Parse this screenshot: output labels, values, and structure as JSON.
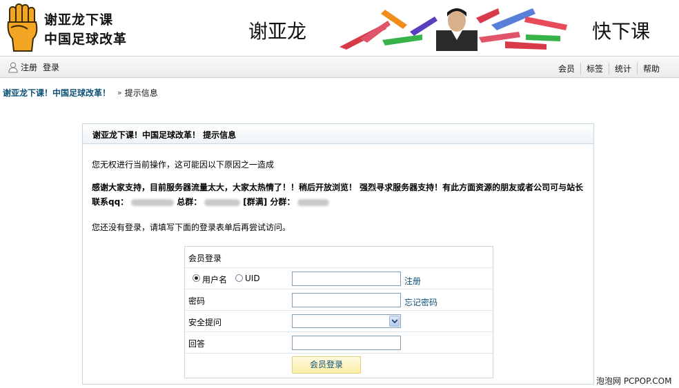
{
  "banner": {
    "logo_line1": "谢亚龙下课",
    "logo_line2": "中国足球改革",
    "left_text": "谢亚龙",
    "right_text": "快下课"
  },
  "nav": {
    "left": [
      {
        "label": "注册",
        "icon": "user-icon"
      },
      {
        "label": "登录"
      }
    ],
    "right": [
      "会员",
      "标签",
      "统计",
      "帮助"
    ]
  },
  "breadcrumb": {
    "home": "谢亚龙下课！中国足球改革！",
    "separator": "»",
    "current": "提示信息"
  },
  "box": {
    "title": "谢亚龙下课！中国足球改革！  提示信息",
    "message": "您无权进行当前操作，这可能因以下原因之一造成",
    "notice_text": "感谢大家支持，目前服务器流量太大，大家太热情了！！稍后开放浏览！  强烈寻求服务器支持！有此方面资源的朋友或者公司可与站长联系qq：",
    "notice_group_label": "总群：",
    "notice_full_label": "[群满] 分群：",
    "login_prompt": "您还没有登录，请填写下面的登录表单后再尝试访问。"
  },
  "login": {
    "title": "会员登录",
    "radio_username": "用户名",
    "radio_uid": "UID",
    "selected": "username",
    "register_link": "注册",
    "password_label": "密码",
    "forgot_link": "忘记密码",
    "security_label": "安全提问",
    "answer_label": "回答",
    "submit_label": "会员登录"
  },
  "watermark": "泡泡网 PCPOP.COM",
  "colors": {
    "link": "#0b4f74",
    "box_border": "#c7d8e4",
    "button_bg": "#fbeea8"
  }
}
